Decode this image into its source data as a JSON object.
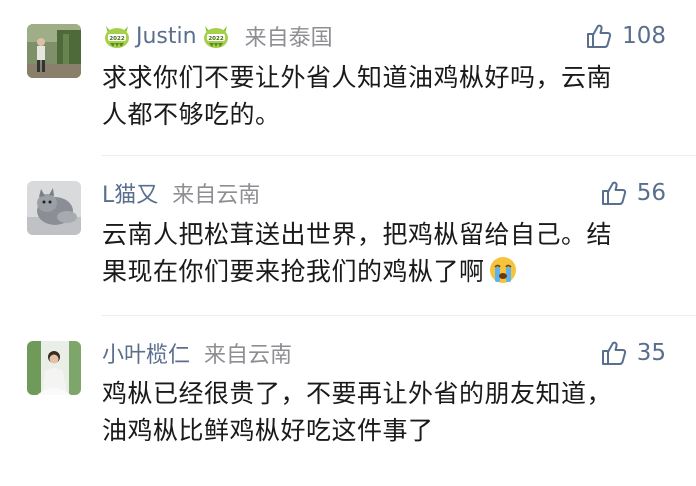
{
  "comments": [
    {
      "username": "Justin",
      "location": "来自泰国",
      "likes": "108",
      "lines": [
        "求求你们不要让外省人知道油鸡枞好吗，云南",
        "人都不够吃的。"
      ],
      "badge_icon": "dragon-badge-icon"
    },
    {
      "username": "L猫又",
      "location": "来自云南",
      "likes": "56",
      "lines": [
        "云南人把松茸送出世界，把鸡枞留给自己。结",
        "果现在你们要来抢我们的鸡枞了啊"
      ],
      "emoji": "crying-face-emoji"
    },
    {
      "username": "小叶榄仁",
      "location": "来自云南",
      "likes": "35",
      "lines": [
        "鸡枞已经很贵了，不要再让外省的朋友知道，",
        "油鸡枞比鲜鸡枞好吃这件事了"
      ]
    }
  ],
  "colors": {
    "username": "#5a6e8e",
    "location": "#8e8e93",
    "text": "#1a1a1a",
    "badge": "#8dbf3a"
  }
}
